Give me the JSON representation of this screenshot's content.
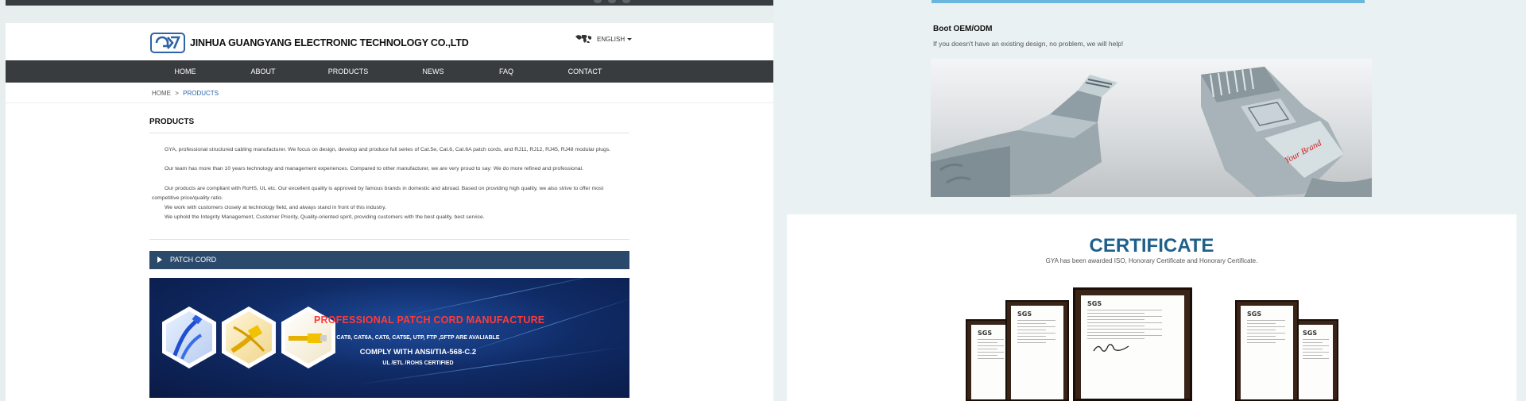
{
  "site": {
    "company_name": "JINHUA GUANGYANG ELECTRONIC TECHNOLOGY CO.,LTD",
    "language": "ENGLISH"
  },
  "nav": {
    "items": [
      "HOME",
      "ABOUT",
      "PRODUCTS",
      "NEWS",
      "FAQ",
      "CONTACT"
    ]
  },
  "breadcrumb": {
    "home": "HOME",
    "separator": ">",
    "current": "PRODUCTS"
  },
  "products": {
    "title": "PRODUCTS",
    "paragraphs": [
      "GYA, professional structured cabling manufacturer. We focus on design, develop and produce full series of Cat.5e, Cat.6, Cat.6A patch cords, and RJ11, RJ12, RJ45, RJ48 modular plugs.",
      "Our team has more than 10 years technology and management experiences. Compared to other manufacturer, we are very proud to say: We do more refined and professional.",
      "Our products are compliant with RoHS, UL etc.  Our excellent quality is approved by famous brands in domestic and abroad. Based on providing high quality, we also strive to offer most competitive price/quality ratio.",
      "We work with customers closely at technology field, and always stand in front of this industry.",
      "We uphold the Integrity Management, Customer Priority, Quality-oriented spirit, providing customers with the best quality, best service."
    ],
    "category": "PATCH CORD"
  },
  "banner": {
    "title": "PROFESSIONAL PATCH CORD MANUFACTURE",
    "line1": "CAT8, CAT6A, CAT6, CAT5E, UTP, FTP ,SFTP ARE AVALIABLE",
    "line2": "COMPLY WITH ANSI/TIA-568-C.2",
    "line3": "UL /ETL /ROHS CERTIFIED"
  },
  "boot": {
    "title": "Boot OEM/ODM",
    "subtitle": "If you doesn't have an existing design, no problem, we will help!",
    "brand_stamp": "Your Brand"
  },
  "certificate": {
    "title": "CERTIFICATE",
    "subtitle": "GYA has been awarded ISO, Honorary Certificate and Honorary Certificate.",
    "issuer": "SGS"
  },
  "colors": {
    "nav_bg": "#383c3f",
    "patch_bar_bg": "#2b4a6b",
    "link_blue": "#2d63a8",
    "banner_red": "#ff3a3a",
    "cert_title": "#1f5f8b"
  }
}
